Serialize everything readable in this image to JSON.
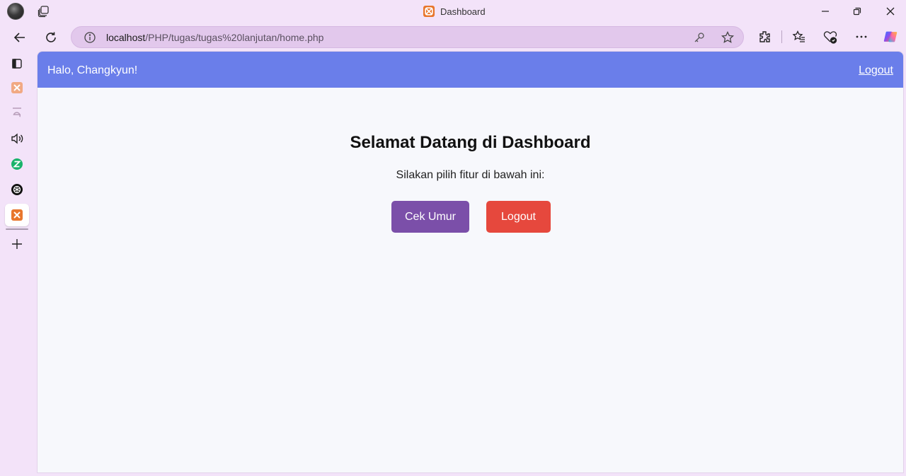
{
  "browser": {
    "tab_title": "Dashboard",
    "url_host": "localhost",
    "url_path": "/PHP/tugas/tugas%20lanjutan/home.php",
    "accent_color": "#6a7eea"
  },
  "icons": {
    "titlebar": [
      "profile-avatar",
      "workspaces-icon",
      "minimize-icon",
      "restore-icon",
      "close-icon"
    ],
    "toolbar": [
      "back-icon",
      "refresh-icon",
      "info-icon",
      "key-icon",
      "star-icon",
      "extensions-icon",
      "favorites-icon",
      "browser-essentials-icon",
      "more-icon",
      "copilot-icon"
    ],
    "sidebar": [
      "tab-actions-icon",
      "xampp-icon",
      "e-icon",
      "read-aloud-icon",
      "z-icon",
      "chatgpt-icon",
      "xampp-active-icon",
      "add-icon"
    ]
  },
  "page": {
    "greeting": "Halo, Changkyun!",
    "header_logout": "Logout",
    "title": "Selamat Datang di Dashboard",
    "subtitle": "Silakan pilih fitur di bawah ini:",
    "buttons": [
      {
        "label": "Cek Umur",
        "color": "#7b4fa9"
      },
      {
        "label": "Logout",
        "color": "#e6483d"
      }
    ]
  }
}
